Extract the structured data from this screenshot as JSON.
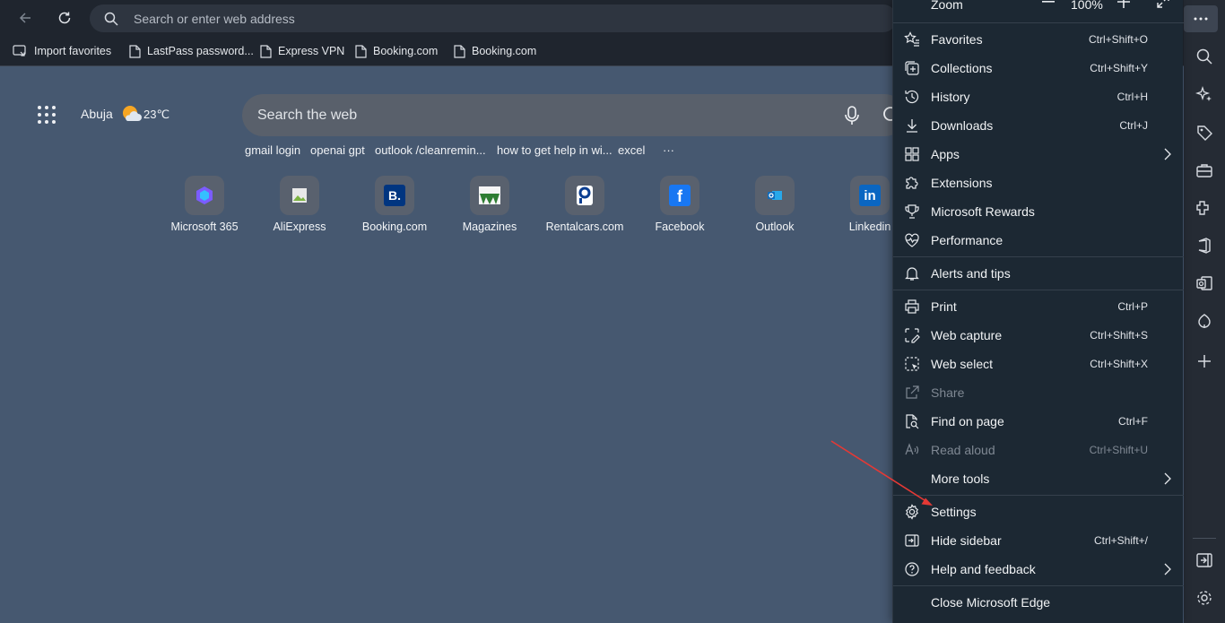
{
  "toolbar": {
    "address_placeholder": "Search or enter web address"
  },
  "favorites_bar": {
    "items": [
      {
        "label": "Import favorites",
        "icon": "import-icon"
      },
      {
        "label": "LastPass password...",
        "icon": "page-icon"
      },
      {
        "label": "Express VPN",
        "icon": "page-icon"
      },
      {
        "label": "Booking.com",
        "icon": "page-icon"
      },
      {
        "label": "Booking.com",
        "icon": "page-icon"
      }
    ]
  },
  "newtab": {
    "city": "Abuja",
    "temperature": "23℃",
    "search_placeholder": "Search the web",
    "trending": [
      "gmail login",
      "openai gpt",
      "outlook /cleanremin...",
      "how to get help in wi...",
      "excel",
      "···"
    ],
    "tiles": [
      {
        "label": "Microsoft 365",
        "color": "#7b5cff"
      },
      {
        "label": "AliExpress",
        "color": "#cccccc"
      },
      {
        "label": "Booking.com",
        "color": "#003580"
      },
      {
        "label": "Magazines",
        "color": "#2e7d32"
      },
      {
        "label": "Rentalcars.com",
        "color": "#0a3d91"
      },
      {
        "label": "Facebook",
        "color": "#1877f2"
      },
      {
        "label": "Outlook",
        "color": "#0f6cbd"
      },
      {
        "label": "Linkedin",
        "color": "#0a66c2"
      }
    ]
  },
  "menu": {
    "zoom_label": "Zoom",
    "zoom_value": "100%",
    "items": [
      {
        "label": "Favorites",
        "shortcut": "Ctrl+Shift+O",
        "icon": "star-list-icon"
      },
      {
        "label": "Collections",
        "shortcut": "Ctrl+Shift+Y",
        "icon": "collections-icon"
      },
      {
        "label": "History",
        "shortcut": "Ctrl+H",
        "icon": "history-icon"
      },
      {
        "label": "Downloads",
        "shortcut": "Ctrl+J",
        "icon": "download-icon"
      },
      {
        "label": "Apps",
        "shortcut": "",
        "icon": "apps-icon",
        "submenu": true
      },
      {
        "label": "Extensions",
        "shortcut": "",
        "icon": "puzzle-icon"
      },
      {
        "label": "Microsoft Rewards",
        "shortcut": "",
        "icon": "trophy-icon"
      },
      {
        "label": "Performance",
        "shortcut": "",
        "icon": "heartbeat-icon"
      },
      {
        "label": "Alerts and tips",
        "shortcut": "",
        "icon": "bell-icon"
      },
      {
        "label": "Print",
        "shortcut": "Ctrl+P",
        "icon": "printer-icon"
      },
      {
        "label": "Web capture",
        "shortcut": "Ctrl+Shift+S",
        "icon": "web-capture-icon"
      },
      {
        "label": "Web select",
        "shortcut": "Ctrl+Shift+X",
        "icon": "web-select-icon"
      },
      {
        "label": "Share",
        "shortcut": "",
        "icon": "share-icon",
        "disabled": true
      },
      {
        "label": "Find on page",
        "shortcut": "Ctrl+F",
        "icon": "find-icon"
      },
      {
        "label": "Read aloud",
        "shortcut": "Ctrl+Shift+U",
        "icon": "read-aloud-icon",
        "disabled": true
      },
      {
        "label": "More tools",
        "shortcut": "",
        "icon": "",
        "submenu": true
      },
      {
        "label": "Settings",
        "shortcut": "",
        "icon": "gear-icon"
      },
      {
        "label": "Hide sidebar",
        "shortcut": "Ctrl+Shift+/",
        "icon": "hide-sidebar-icon"
      },
      {
        "label": "Help and feedback",
        "shortcut": "",
        "icon": "help-icon",
        "submenu": true
      },
      {
        "label": "Close Microsoft Edge",
        "shortcut": "",
        "icon": ""
      }
    ]
  },
  "colors": {
    "page_bg": "#465870",
    "menu_bg": "#1c2833",
    "arrow": "#e53935"
  }
}
